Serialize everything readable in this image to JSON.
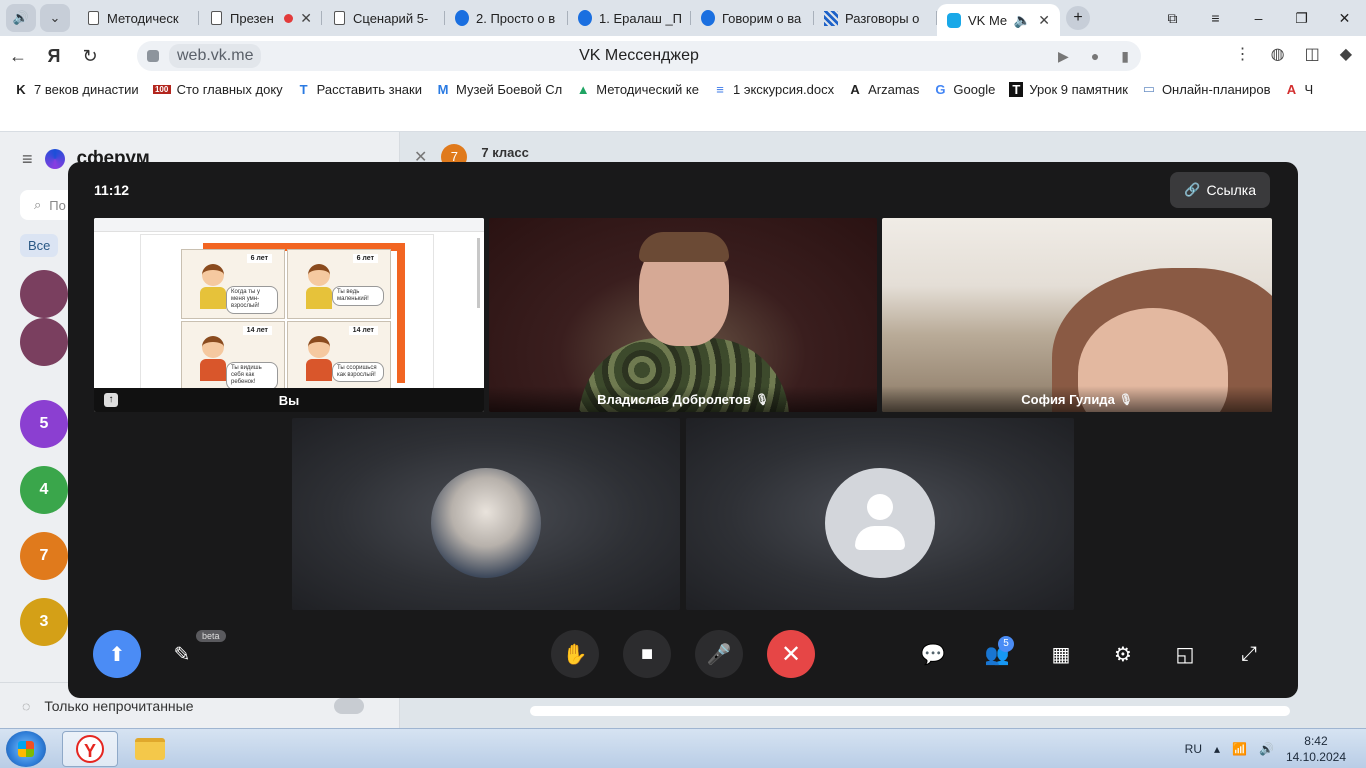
{
  "browser": {
    "tabs": [
      {
        "label": "Методическ",
        "icon": "doc"
      },
      {
        "label": "Презен",
        "icon": "doc",
        "recording": true
      },
      {
        "label": "Сценарий 5-",
        "icon": "doc"
      },
      {
        "label": "2. Просто о в",
        "icon": "cloud"
      },
      {
        "label": "1. Ералаш _П",
        "icon": "cloud"
      },
      {
        "label": "Говорим о ва",
        "icon": "cloud"
      },
      {
        "label": "Разговоры о",
        "icon": "stripe"
      },
      {
        "label": "VK Мес",
        "icon": "vk",
        "active": true
      }
    ],
    "new_tab": "+",
    "url": "web.vk.me",
    "page_title": "VK Мессенджер",
    "bookmarks": [
      {
        "icon": "K",
        "label": "7 веков династии"
      },
      {
        "icon": "100",
        "label": "Сто главных доку"
      },
      {
        "icon": "T",
        "label": "Расставить знаки"
      },
      {
        "icon": "M",
        "label": "Музей Боевой Сл"
      },
      {
        "icon": "▲",
        "label": "Методический ке"
      },
      {
        "icon": "≡",
        "label": "1 экскурсия.docx"
      },
      {
        "icon": "A",
        "label": "Arzamas"
      },
      {
        "icon": "G",
        "label": "Google"
      },
      {
        "icon": "T",
        "label": "Урок 9 памятник"
      },
      {
        "icon": "▭",
        "label": "Онлайн-планиров"
      },
      {
        "icon": "A",
        "label": "Ч"
      }
    ]
  },
  "vk": {
    "logo": "сферум",
    "search_placeholder": "По",
    "chip_all": "Все",
    "sidebar_avatars": [
      "5",
      "4",
      "7",
      "3"
    ],
    "only_unread": "Только непрочитанные",
    "chat_avatar": "7",
    "chat_title": "7 класс"
  },
  "call": {
    "time": "11:12",
    "link_label": "Ссылка",
    "participants": {
      "self": "Вы",
      "vlad": "Владислав Добролетов",
      "sofia": "София Гулида"
    },
    "shared_screen": {
      "ages": [
        "6 лет",
        "6 лет",
        "14 лет",
        "14 лет"
      ],
      "bubbles": [
        "Когда ты у меня умн-взрослый!",
        "Ты ведь маленький!",
        "Ты видишь себя как ребенок!",
        "Ты ссоришься как взрослый!"
      ]
    },
    "beta_label": "beta",
    "participants_count": "5"
  },
  "taskbar": {
    "lang": "RU",
    "time": "8:42",
    "date": "14.10.2024"
  }
}
